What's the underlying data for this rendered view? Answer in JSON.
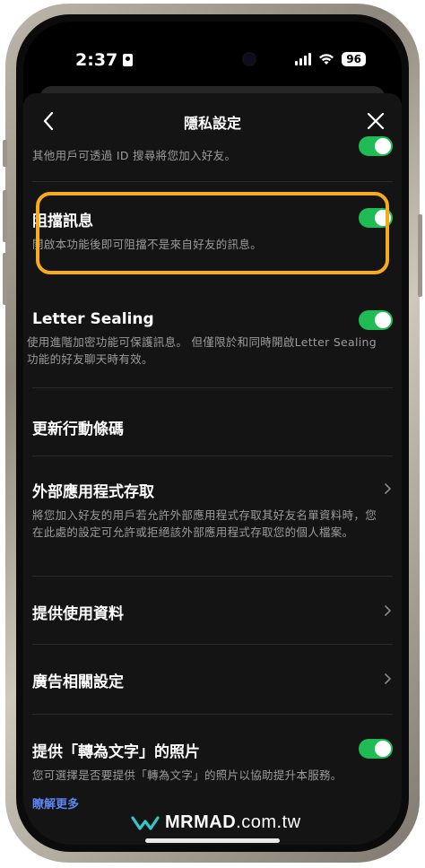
{
  "status_bar": {
    "time": "2:37",
    "battery": "96"
  },
  "nav": {
    "title": "隱私設定"
  },
  "items": [
    {
      "id": "add-by-id",
      "label": "",
      "desc": "其他用戶可透過 ID 搜尋將您加入好友。",
      "control": "toggle",
      "on": true
    },
    {
      "id": "block-messages",
      "label": "阻擋訊息",
      "desc": "開啟本功能後即可阻擋不是來自好友的訊息。",
      "control": "toggle",
      "on": true
    },
    {
      "id": "letter-sealing",
      "label": "Letter Sealing",
      "desc": "使用進階加密功能可保護訊息。 但僅限於和同時開啟Letter Sealing功能的好友聊天時有效。",
      "control": "toggle",
      "on": true
    },
    {
      "id": "update-action-code",
      "label": "更新行動條碼",
      "desc": "",
      "control": "none"
    },
    {
      "id": "external-app-access",
      "label": "外部應用程式存取",
      "desc": "將您加入好友的用戶若允許外部應用程式存取其好友名單資料時，您在此處的設定可允許或拒絕該外部應用程式存取您的個人檔案。",
      "control": "chevron"
    },
    {
      "id": "provide-usage-data",
      "label": "提供使用資料",
      "desc": "",
      "control": "chevron"
    },
    {
      "id": "ad-settings",
      "label": "廣告相關設定",
      "desc": "",
      "control": "chevron"
    },
    {
      "id": "photo-to-text",
      "label": "提供「轉為文字」的照片",
      "desc": "您可選擇是否要提供「轉為文字」的照片以協助提升本服務。",
      "control": "toggle",
      "on": true
    }
  ],
  "learn_more": "瞭解更多",
  "watermark": {
    "brand": "MRMAD",
    "suffix": ".com.tw"
  },
  "colors": {
    "accent_green": "#1fbb54",
    "highlight": "#f5ab1e",
    "link": "#5f86f0"
  }
}
